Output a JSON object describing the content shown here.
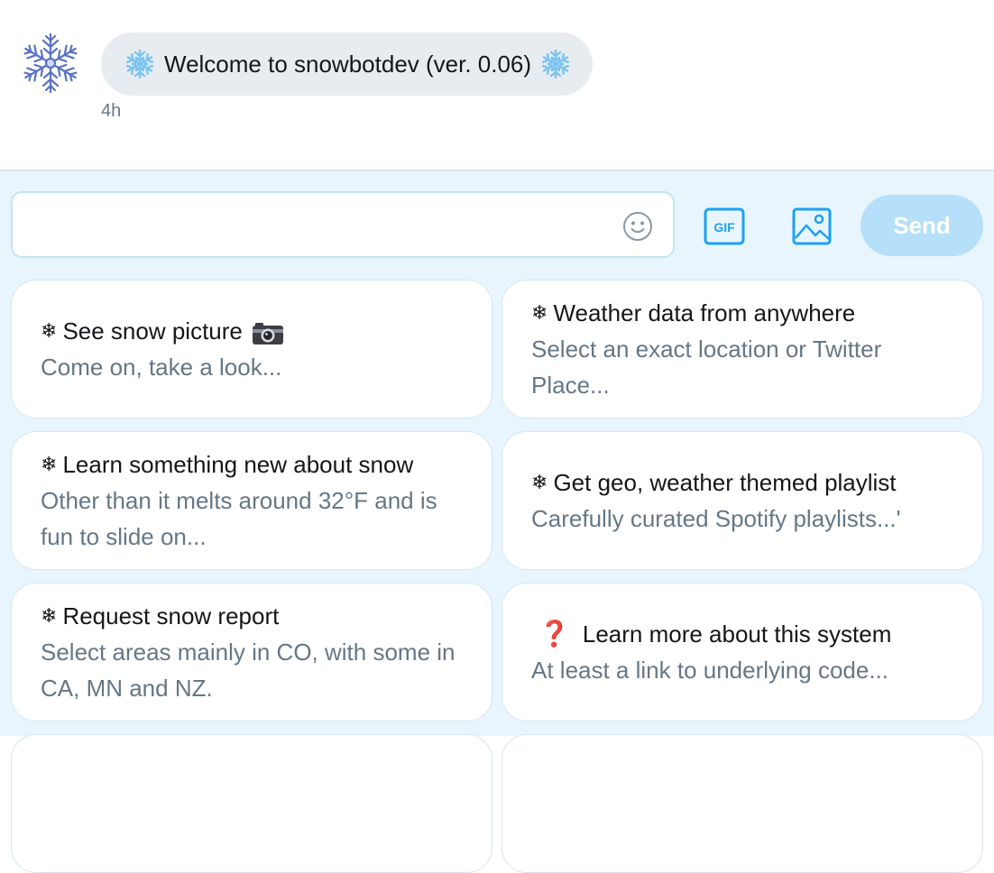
{
  "conversation": {
    "bot_avatar_icon": "snowflake-avatar-icon",
    "welcome_message": "Welcome to snowbotdev (ver. 0.06)",
    "message_emoji": "snowflake-icon",
    "timestamp": "4h"
  },
  "composer": {
    "input_placeholder": "",
    "emoji_icon": "smiley-icon",
    "gif_label": "GIF",
    "image_icon": "image-icon",
    "send_label": "Send"
  },
  "quick_replies": [
    {
      "prefix": "❄",
      "title": "See snow picture",
      "icon": "camera-icon",
      "description": "Come on, take a look..."
    },
    {
      "prefix": "❄",
      "title": "Weather data from anywhere",
      "description": "Select an exact location or Twitter Place..."
    },
    {
      "prefix": "❄",
      "title": "Learn something new about snow",
      "description": "Other than it melts around 32°F and is fun to slide on..."
    },
    {
      "prefix": "❄",
      "title": "Get geo, weather themed playlist",
      "description": "Carefully curated Spotify playlists...'"
    },
    {
      "prefix": "❄",
      "title": "Request snow report",
      "description": "Select areas mainly in CO, with some in CA, MN and NZ."
    },
    {
      "prefix": "❓",
      "title": "Learn more about this system",
      "description": "At least a link to underlying code..."
    }
  ],
  "colors": {
    "accent": "#1da1f2",
    "composer_bg": "#e8f5fd",
    "bubble_bg": "#e6ecf0",
    "send_disabled": "#b6dff9",
    "muted_text": "#657786"
  }
}
